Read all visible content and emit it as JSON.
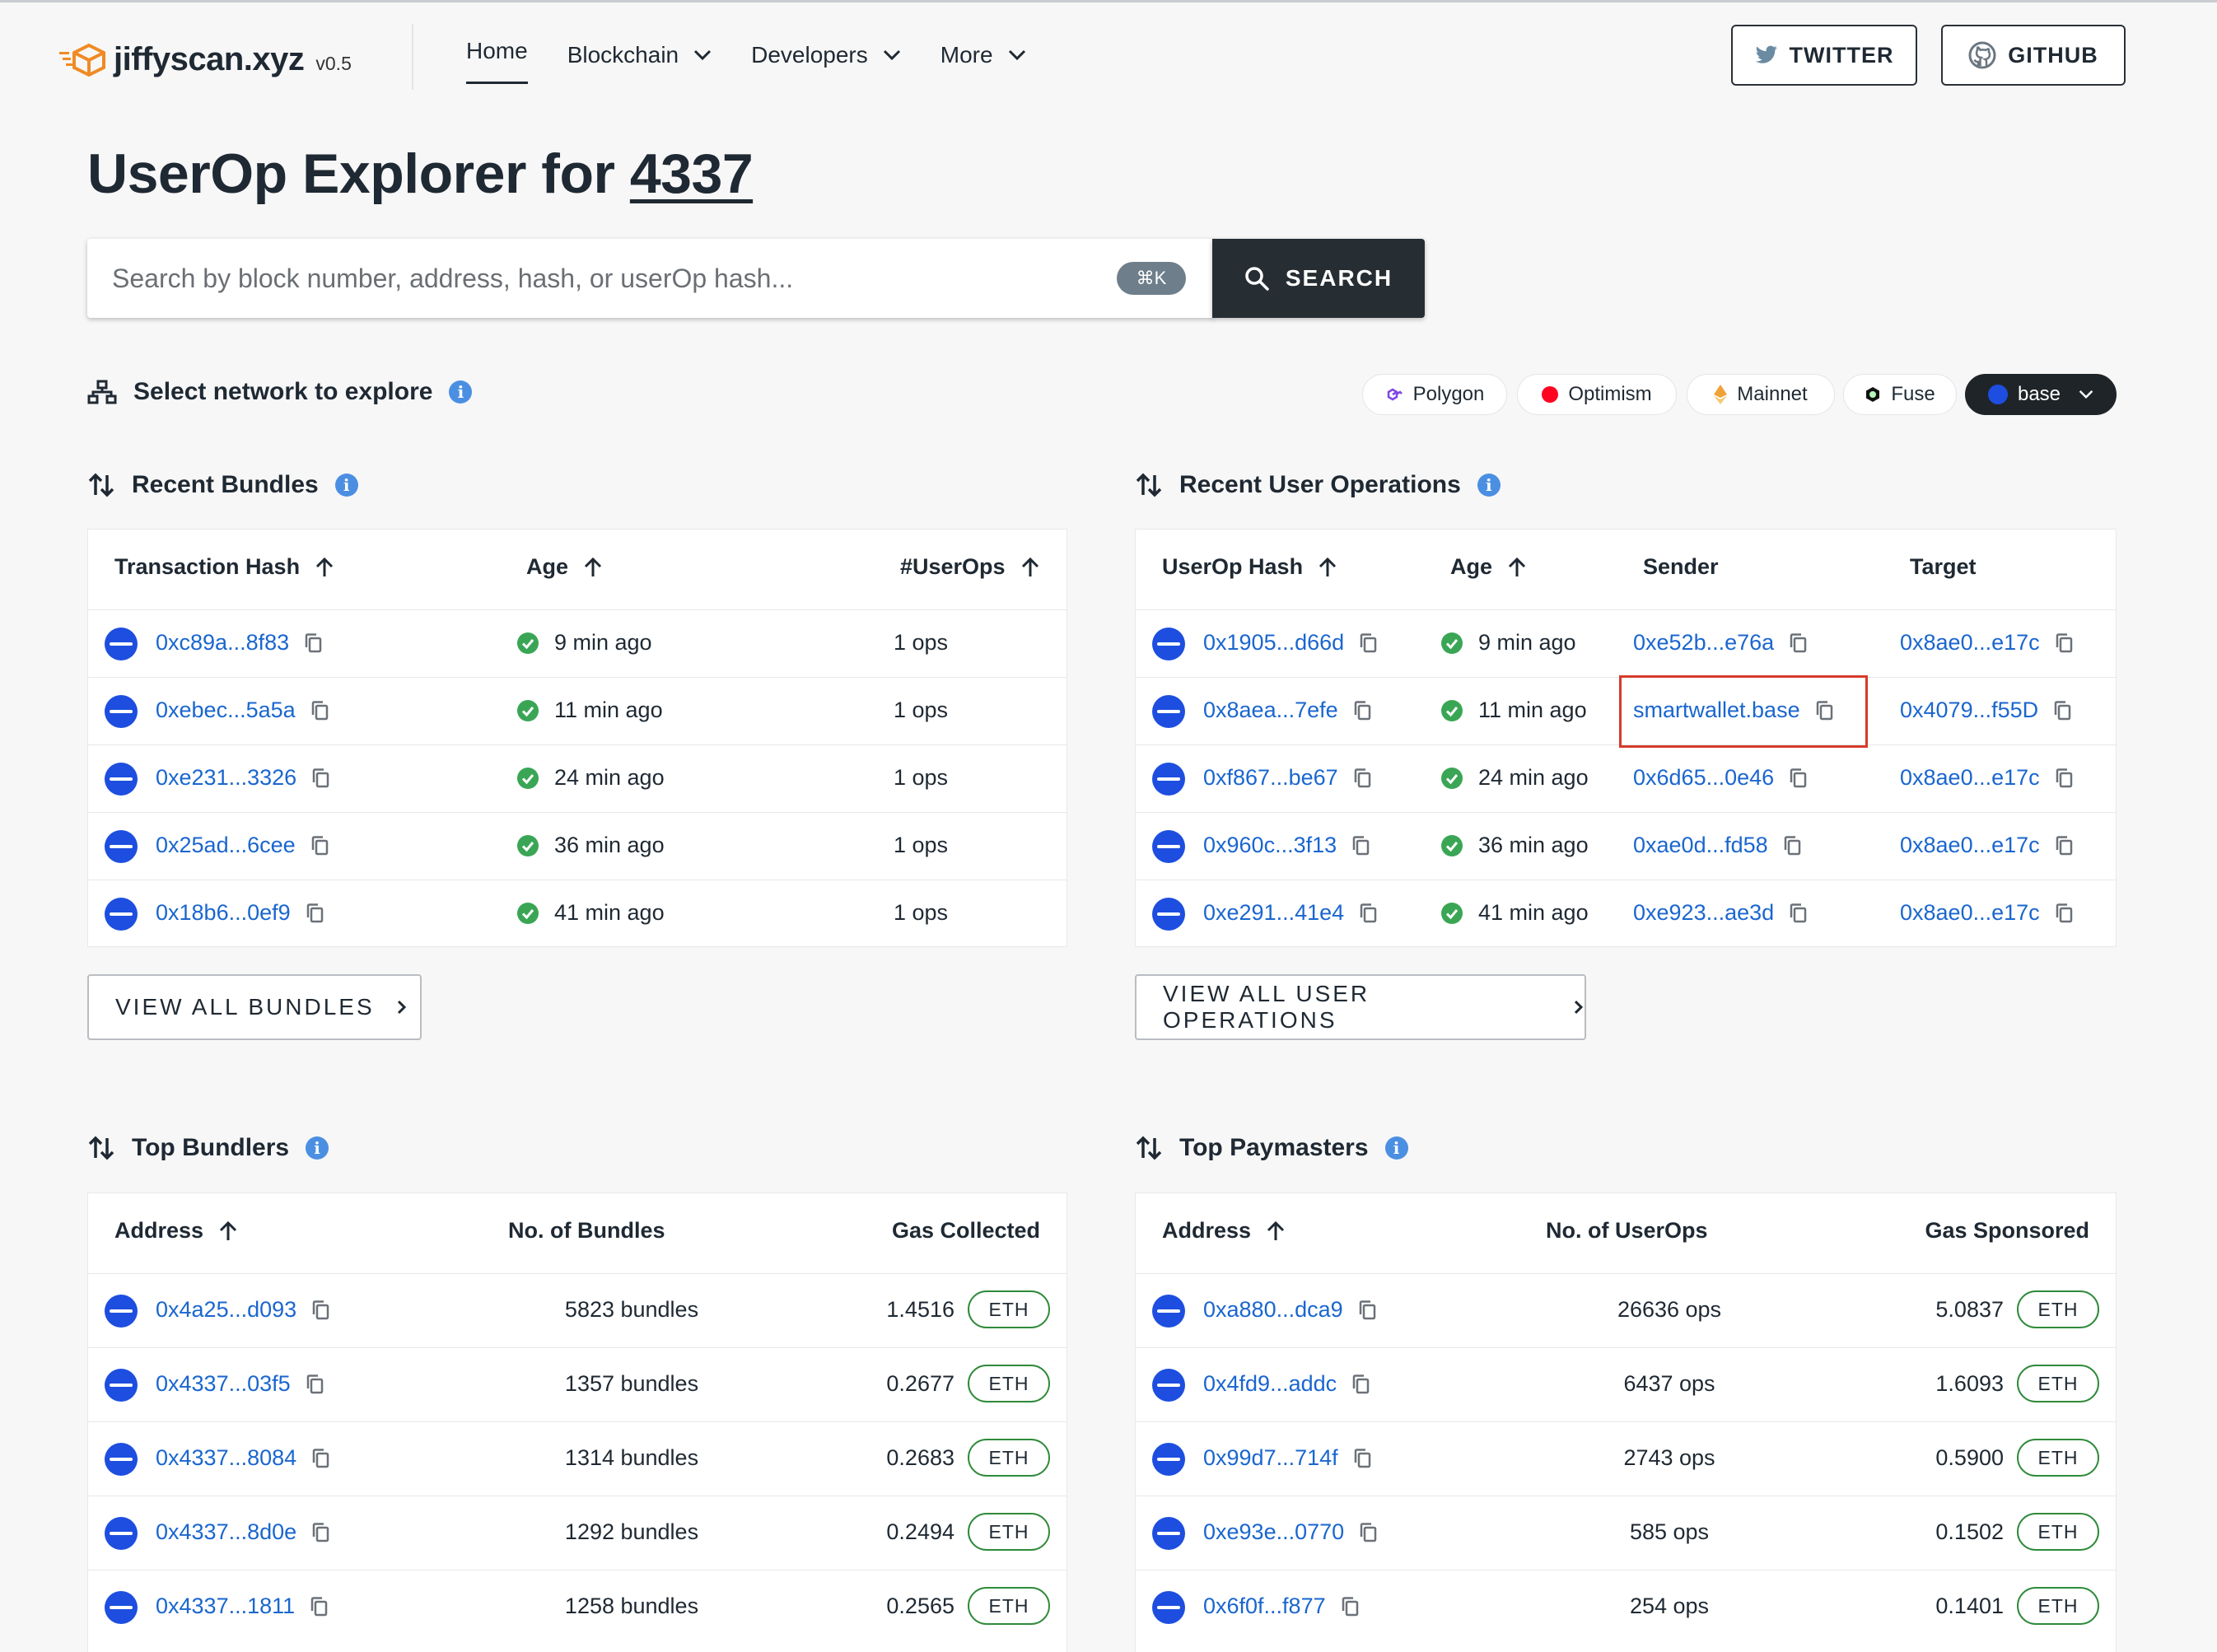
{
  "app": {
    "name": "jiffyscan.xyz",
    "version": "v0.5"
  },
  "nav": {
    "home": "Home",
    "blockchain": "Blockchain",
    "developers": "Developers",
    "more": "More"
  },
  "header_buttons": {
    "twitter": "TWITTER",
    "github": "GITHUB"
  },
  "page": {
    "title_prefix": "UserOp Explorer for",
    "title_link": "4337"
  },
  "search": {
    "placeholder": "Search by block number, address, hash, or userOp hash...",
    "shortcut": "⌘K",
    "button_label": "SEARCH"
  },
  "network": {
    "label": "Select network to explore",
    "options": [
      {
        "name": "Polygon",
        "color": "#8247e5"
      },
      {
        "name": "Optimism",
        "color": "#ff0420"
      },
      {
        "name": "Mainnet",
        "color": "#f0a236"
      },
      {
        "name": "Fuse",
        "color": "#111111"
      },
      {
        "name": "base",
        "color": "#1d4ee0",
        "selected": true
      }
    ]
  },
  "recent_bundles": {
    "title": "Recent Bundles",
    "headers": [
      "Transaction Hash",
      "Age",
      "#UserOps"
    ],
    "rows": [
      {
        "hash": "0xc89a...8f83",
        "age": "9 min ago",
        "ops": "1 ops"
      },
      {
        "hash": "0xebec...5a5a",
        "age": "11 min ago",
        "ops": "1 ops"
      },
      {
        "hash": "0xe231...3326",
        "age": "24 min ago",
        "ops": "1 ops"
      },
      {
        "hash": "0x25ad...6cee",
        "age": "36 min ago",
        "ops": "1 ops"
      },
      {
        "hash": "0x18b6...0ef9",
        "age": "41 min ago",
        "ops": "1 ops"
      }
    ],
    "view_all": "VIEW ALL BUNDLES"
  },
  "recent_userops": {
    "title": "Recent User Operations",
    "headers": [
      "UserOp Hash",
      "Age",
      "Sender",
      "Target"
    ],
    "rows": [
      {
        "hash": "0x1905...d66d",
        "age": "9 min ago",
        "sender": "0xe52b...e76a",
        "target": "0x8ae0...e17c"
      },
      {
        "hash": "0x8aea...7efe",
        "age": "11 min ago",
        "sender": "smartwallet.base",
        "target": "0x4079...f55D"
      },
      {
        "hash": "0xf867...be67",
        "age": "24 min ago",
        "sender": "0x6d65...0e46",
        "target": "0x8ae0...e17c"
      },
      {
        "hash": "0x960c...3f13",
        "age": "36 min ago",
        "sender": "0xae0d...fd58",
        "target": "0x8ae0...e17c"
      },
      {
        "hash": "0xe291...41e4",
        "age": "41 min ago",
        "sender": "0xe923...ae3d",
        "target": "0x8ae0...e17c"
      }
    ],
    "view_all": "VIEW ALL USER OPERATIONS"
  },
  "top_bundlers": {
    "title": "Top Bundlers",
    "headers": [
      "Address",
      "No. of Bundles",
      "Gas Collected"
    ],
    "rows": [
      {
        "address": "0x4a25...d093",
        "count": "5823 bundles",
        "gas": "1.4516",
        "unit": "ETH"
      },
      {
        "address": "0x4337...03f5",
        "count": "1357 bundles",
        "gas": "0.2677",
        "unit": "ETH"
      },
      {
        "address": "0x4337...8084",
        "count": "1314 bundles",
        "gas": "0.2683",
        "unit": "ETH"
      },
      {
        "address": "0x4337...8d0e",
        "count": "1292 bundles",
        "gas": "0.2494",
        "unit": "ETH"
      },
      {
        "address": "0x4337...1811",
        "count": "1258 bundles",
        "gas": "0.2565",
        "unit": "ETH"
      }
    ]
  },
  "top_paymasters": {
    "title": "Top Paymasters",
    "headers": [
      "Address",
      "No. of UserOps",
      "Gas Sponsored"
    ],
    "rows": [
      {
        "address": "0xa880...dca9",
        "count": "26636 ops",
        "gas": "5.0837",
        "unit": "ETH"
      },
      {
        "address": "0x4fd9...addc",
        "count": "6437 ops",
        "gas": "1.6093",
        "unit": "ETH"
      },
      {
        "address": "0x99d7...714f",
        "count": "2743 ops",
        "gas": "0.5900",
        "unit": "ETH"
      },
      {
        "address": "0xe93e...0770",
        "count": "585 ops",
        "gas": "0.1502",
        "unit": "ETH"
      },
      {
        "address": "0x6f0f...f877",
        "count": "254 ops",
        "gas": "0.1401",
        "unit": "ETH"
      }
    ]
  }
}
